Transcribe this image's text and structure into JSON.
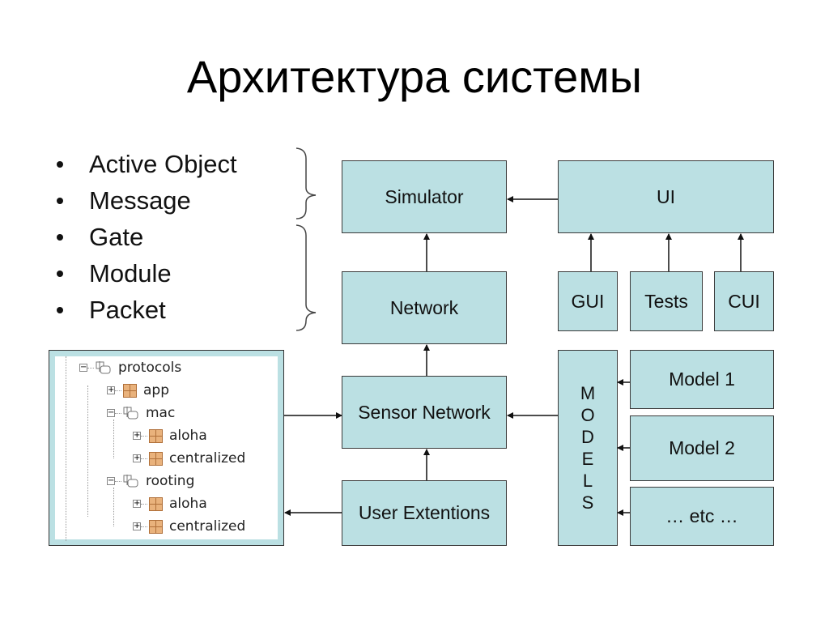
{
  "title": "Архитектура системы",
  "bullets": [
    "Active Object",
    "Message",
    "Gate",
    "Module",
    "Packet"
  ],
  "boxes": {
    "simulator": "Simulator",
    "ui": "UI",
    "network": "Network",
    "gui": "GUI",
    "tests": "Tests",
    "cui": "CUI",
    "sensor_network": "Sensor Network",
    "user_extentions": "User Extentions",
    "models_letters": [
      "M",
      "O",
      "D",
      "E",
      "L",
      "S"
    ],
    "model1": "Model 1",
    "model2": "Model 2",
    "etc": "… etc …"
  },
  "tree": {
    "items": [
      {
        "label": "protocols",
        "type": "package",
        "expander": "−",
        "level": 0
      },
      {
        "label": "app",
        "type": "module",
        "expander": "+",
        "level": 1
      },
      {
        "label": "mac",
        "type": "package",
        "expander": "−",
        "level": 1
      },
      {
        "label": "aloha",
        "type": "module",
        "expander": "+",
        "level": 2
      },
      {
        "label": "centralized",
        "type": "module",
        "expander": "+",
        "level": 2
      },
      {
        "label": "rooting",
        "type": "package",
        "expander": "−",
        "level": 1
      },
      {
        "label": "aloha",
        "type": "module",
        "expander": "+",
        "level": 2
      },
      {
        "label": "centralized",
        "type": "module",
        "expander": "+",
        "level": 2
      }
    ]
  },
  "colors": {
    "box_fill": "#BBE0E3",
    "box_border": "#3a3a3a",
    "module_icon": "#E9B27C"
  }
}
